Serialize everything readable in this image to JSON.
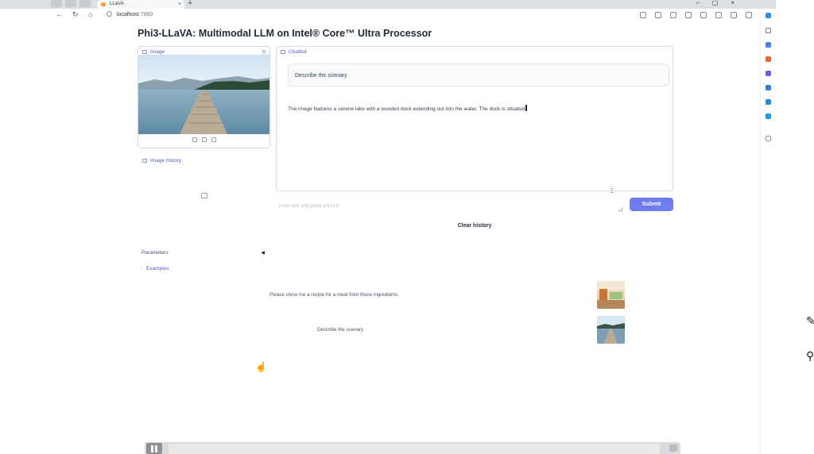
{
  "browser": {
    "tab_title": "LLaVA",
    "tab_close": "×",
    "new_tab": "+",
    "url_host": "localhost",
    "url_port": ":7860",
    "nav_back": "←",
    "nav_refresh": "↻",
    "nav_home": "⌂",
    "win_min": "–",
    "win_max": "▢",
    "win_close": "×"
  },
  "page": {
    "title": "Phi3-LLaVA: Multimodal LLM on Intel® Core™ Ultra Processor"
  },
  "image_panel": {
    "label": "Image",
    "close": "×",
    "history_label": "Image history"
  },
  "chatbot": {
    "label": "Chatbot",
    "user_message": "Describe the scenary",
    "bot_message": "The image features a serene lake with a wooden dock extending out into the water. The dock is situated"
  },
  "input": {
    "placeholder": "Enter text and press ENTER",
    "value": ""
  },
  "buttons": {
    "submit": "Submit",
    "clear_history": "Clear history"
  },
  "parameters": {
    "label": "Parameters",
    "toggle": "◀"
  },
  "examples": {
    "label": "Examples",
    "items": [
      {
        "text": "Please show me a recipe for a meal from these ingredients"
      },
      {
        "text": "Describe the scenary"
      }
    ]
  },
  "icons": {
    "mouse_cursor": "pointer-hand-icon",
    "text_cursor": "text-select-cursor-icon"
  },
  "colors": {
    "accent": "#6f7df0",
    "label_blue": "#4b5cc4",
    "border": "#d7dae0"
  }
}
